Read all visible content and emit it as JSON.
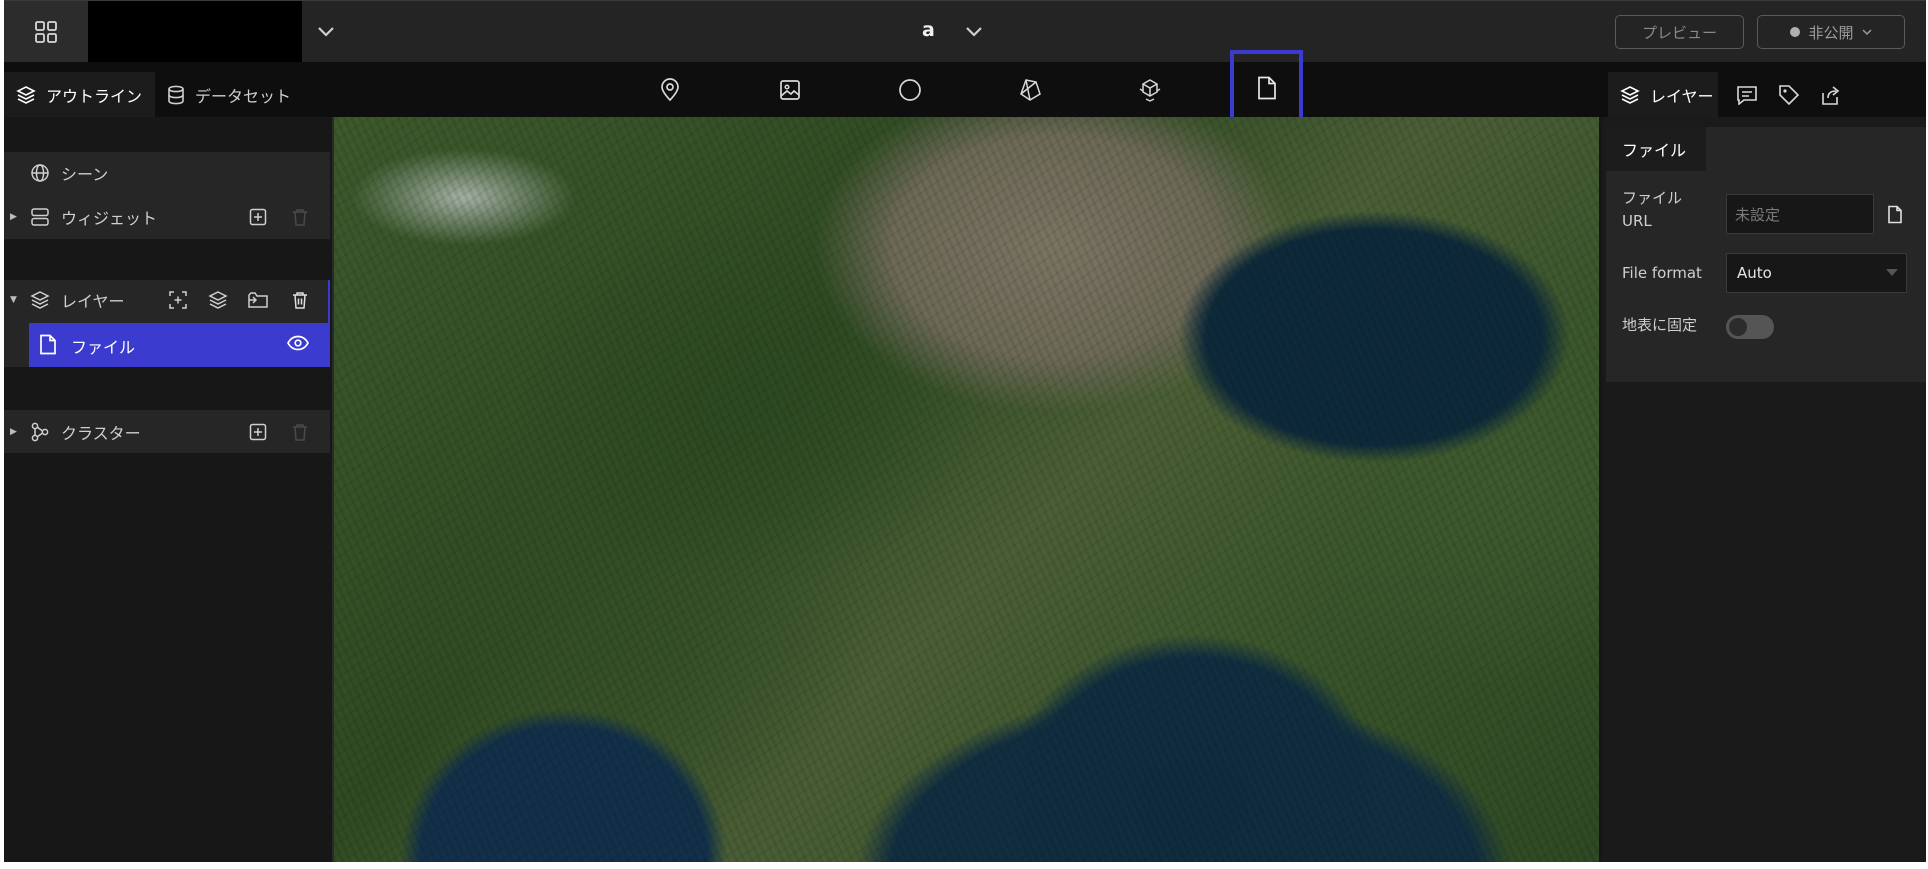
{
  "header": {
    "scene_name": "a",
    "preview_label": "プレビュー",
    "publish_label": "非公開"
  },
  "left": {
    "tabs": [
      {
        "label": "アウトライン",
        "active": true
      },
      {
        "label": "データセット",
        "active": false
      }
    ],
    "tree": {
      "scene": "シーン",
      "widget": "ウィジェット",
      "layer": "レイヤー",
      "layer_file": "ファイル",
      "cluster": "クラスター"
    }
  },
  "toolbar": {
    "tools": [
      "marker-icon",
      "image-icon",
      "circle-icon",
      "polygon-icon",
      "model-icon",
      "file-icon"
    ],
    "highlighted": "file-icon"
  },
  "right": {
    "tabs": [
      {
        "label": "レイヤー",
        "active": true,
        "icon": "layers-icon"
      },
      {
        "label": "",
        "icon": "infobox-icon"
      },
      {
        "label": "",
        "icon": "tag-icon"
      },
      {
        "label": "",
        "icon": "export-icon"
      }
    ],
    "section_tab": "ファイル",
    "fields": {
      "url_label_line1": "ファイル",
      "url_label_line2": "URL",
      "url_placeholder": "未設定",
      "format_label": "File format",
      "format_value": "Auto",
      "clamp_label": "地表に固定",
      "clamp_value": false
    }
  },
  "colors": {
    "accent": "#3b3bd0",
    "header_bg": "#242424",
    "panel_bg": "#171717"
  }
}
